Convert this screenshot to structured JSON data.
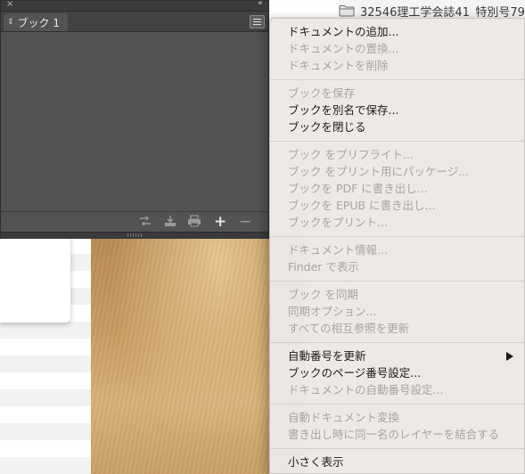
{
  "finder": {
    "top_item_label": "32546理工学会誌41_特別号79"
  },
  "panel": {
    "tab_label": "ブック 1",
    "tab_arrows": "⇕",
    "close_glyph": "×",
    "collapse_glyph": "‹‹",
    "footer_icons": [
      "sync-styles-icon",
      "save-book-icon",
      "print-book-icon",
      "add-document-icon",
      "remove-document-icon"
    ],
    "add_glyph": "+",
    "remove_glyph": "−"
  },
  "menu": {
    "items": [
      {
        "label": "ドキュメントの追加...",
        "enabled": true
      },
      {
        "label": "ドキュメントの置換...",
        "enabled": false
      },
      {
        "label": "ドキュメントを削除",
        "enabled": false
      },
      {
        "label": "ブックを保存",
        "enabled": false
      },
      {
        "label": "ブックを別名で保存...",
        "enabled": true
      },
      {
        "label": "ブックを閉じる",
        "enabled": true
      },
      {
        "label": "ブック をプリフライト...",
        "enabled": false
      },
      {
        "label": "ブック をプリント用にパッケージ...",
        "enabled": false
      },
      {
        "label": "ブックを PDF に書き出し...",
        "enabled": false
      },
      {
        "label": "ブックを EPUB に書き出し...",
        "enabled": false
      },
      {
        "label": "ブックをプリント...",
        "enabled": false
      },
      {
        "label": "ドキュメント情報...",
        "enabled": false
      },
      {
        "label": "Finder で表示",
        "enabled": false
      },
      {
        "label": "ブック を同期",
        "enabled": false
      },
      {
        "label": "同期オプション...",
        "enabled": false
      },
      {
        "label": "すべての相互参照を更新",
        "enabled": false
      },
      {
        "label": "自動番号を更新",
        "enabled": true,
        "submenu": true
      },
      {
        "label": "ブックのページ番号設定...",
        "enabled": true
      },
      {
        "label": "ドキュメントの自動番号設定...",
        "enabled": false
      },
      {
        "label": "自動ドキュメント変換",
        "enabled": false
      },
      {
        "label": "書き出し時に同一名のレイヤーを結合する",
        "enabled": false
      },
      {
        "label": "小さく表示",
        "enabled": true
      }
    ]
  }
}
